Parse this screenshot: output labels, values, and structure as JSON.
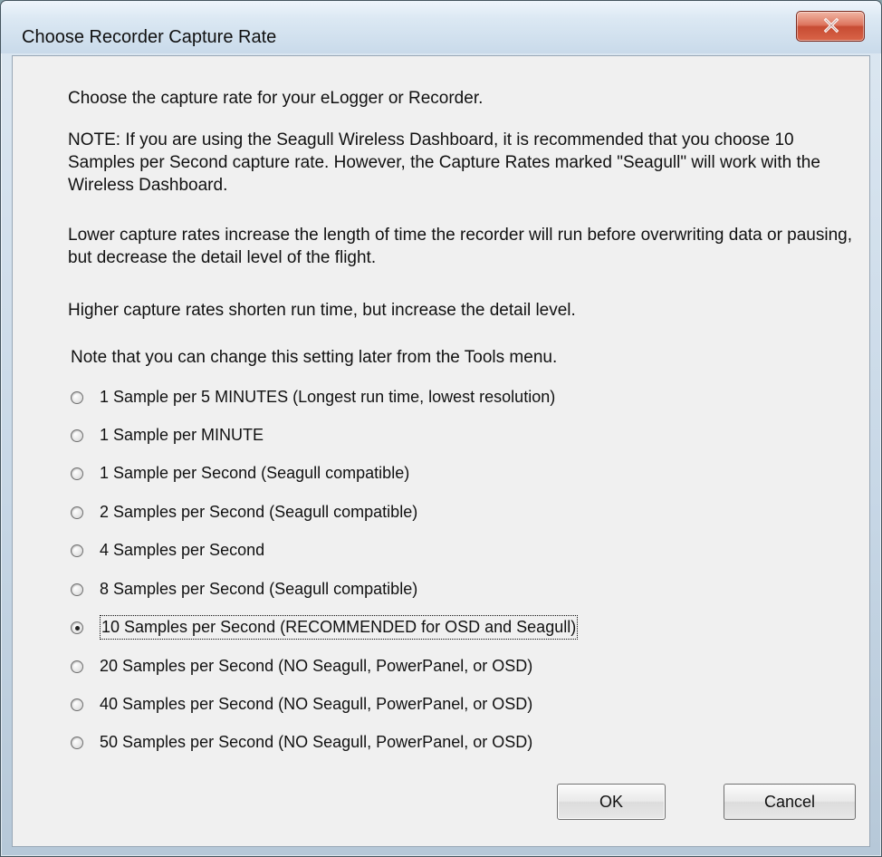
{
  "window": {
    "title": "Choose Recorder Capture Rate",
    "close_icon": "close-icon"
  },
  "dialog": {
    "intro": "Choose the capture rate for your eLogger or Recorder.",
    "note": "NOTE:  If you are using the Seagull Wireless Dashboard, it is recommended that you choose 10 Samples per Second capture rate.   However, the Capture Rates marked \"Seagull\" will work with the Wireless Dashboard.",
    "lower_rates": "Lower capture rates increase the length of time the recorder will run before overwriting data or pausing, but decrease the detail level of the flight.",
    "higher_rates": "Higher capture rates shorten run time, but increase the detail level.",
    "change_later": "Note that you can change this setting later from the Tools menu."
  },
  "options": [
    {
      "label": "1 Sample per 5 MINUTES (Longest run time, lowest resolution)",
      "selected": false
    },
    {
      "label": "1 Sample per MINUTE",
      "selected": false
    },
    {
      "label": "1 Sample per Second (Seagull compatible)",
      "selected": false
    },
    {
      "label": "2 Samples per Second (Seagull compatible)",
      "selected": false
    },
    {
      "label": "4 Samples per Second",
      "selected": false
    },
    {
      "label": "8 Samples per Second (Seagull compatible)",
      "selected": false
    },
    {
      "label": "10 Samples per Second (RECOMMENDED for OSD and Seagull)",
      "selected": true
    },
    {
      "label": "20 Samples per Second (NO Seagull, PowerPanel, or OSD)",
      "selected": false
    },
    {
      "label": "40 Samples per Second (NO Seagull, PowerPanel, or OSD)",
      "selected": false
    },
    {
      "label": "50 Samples per Second (NO Seagull, PowerPanel, or OSD)",
      "selected": false
    }
  ],
  "buttons": {
    "ok": "OK",
    "cancel": "Cancel"
  }
}
